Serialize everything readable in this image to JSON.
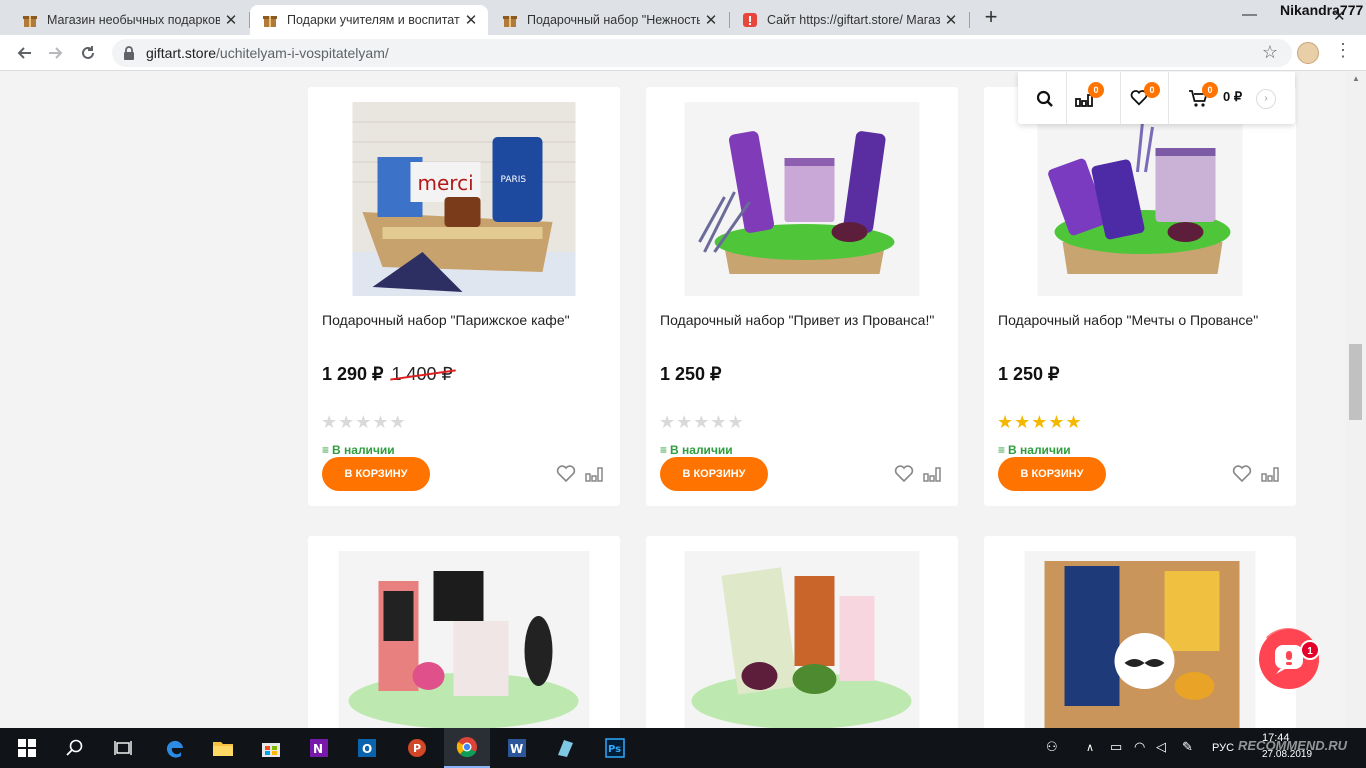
{
  "browser": {
    "tabs": [
      {
        "title": "Магазин необычных подарков",
        "active": false
      },
      {
        "title": "Подарки учителям и воспитате",
        "active": true
      },
      {
        "title": "Подарочный набор \"Нежность\"",
        "active": false
      },
      {
        "title": "Сайт https://giftart.store/ Магази",
        "active": false
      }
    ],
    "user_name": "Nikandra777",
    "url_domain": "giftart.store",
    "url_path": "/uchitelyam-i-vospitatelyam/"
  },
  "header_widget": {
    "compare_count": "0",
    "wishlist_count": "0",
    "cart_count": "0",
    "cart_total": "0 ₽"
  },
  "products": [
    {
      "title": "Подарочный набор \"Парижское кафе\"",
      "price": "1 290 ₽",
      "old_price": "1 400 ₽",
      "rating": 0,
      "stars": "★★★★★",
      "stock": "В наличии",
      "cart_label": "В КОРЗИНУ"
    },
    {
      "title": "Подарочный набор \"Привет из Прованса!\"",
      "price": "1 250 ₽",
      "old_price": "",
      "rating": 0,
      "stars": "★★★★★",
      "stock": "В наличии",
      "cart_label": "В КОРЗИНУ"
    },
    {
      "title": "Подарочный набор \"Мечты о Провансе\"",
      "price": "1 250 ₽",
      "old_price": "",
      "rating": 5,
      "stars": "★★★★★",
      "stock": "В наличии",
      "cart_label": "В КОРЗИНУ"
    }
  ],
  "chat": {
    "badge": "1"
  },
  "taskbar": {
    "lang": "РУС",
    "time": "17:44",
    "date": "27.08.2019",
    "watermark": "RECOMMEND.RU"
  },
  "colors": {
    "accent": "#ff7300",
    "stock": "#2e9f3e",
    "star": "#f5b800",
    "old_price_strike": "#e0201f"
  }
}
